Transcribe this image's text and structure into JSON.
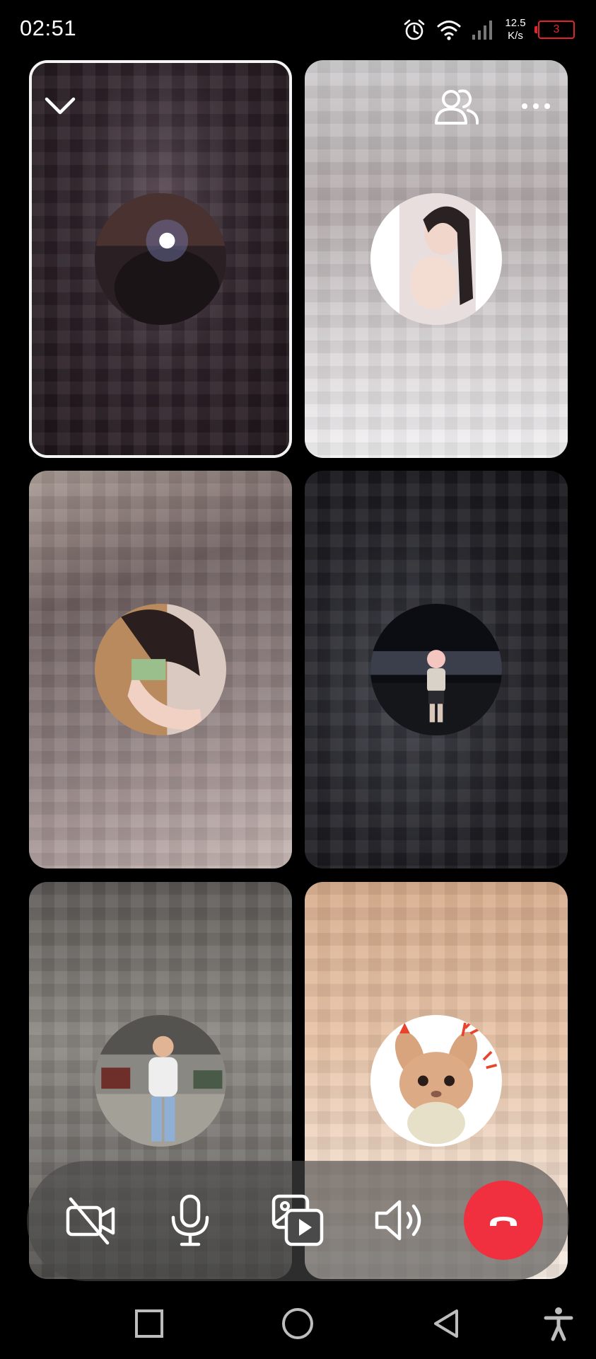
{
  "status_bar": {
    "time": "02:51",
    "net_speed_value": "12.5",
    "net_speed_unit": "K/s",
    "battery_level": "3",
    "icons": [
      "alarm-icon",
      "wifi-icon",
      "cell-signal-icon",
      "battery-icon"
    ]
  },
  "call": {
    "participant_count": 6,
    "participants": [
      {
        "id": 1,
        "role": "self-view",
        "avatar": "dark-room-selfie",
        "selected": true
      },
      {
        "id": 2,
        "avatar": "girl-portrait-photo"
      },
      {
        "id": 3,
        "avatar": "girl-lying-photo"
      },
      {
        "id": 4,
        "avatar": "man-night-street-photo"
      },
      {
        "id": 5,
        "avatar": "man-parking-lot-photo"
      },
      {
        "id": 6,
        "avatar": "plush-bunny-sticker"
      }
    ],
    "tile_icons": {
      "collapse": "chevron-down-icon",
      "participants": "people-icon",
      "more": "more-icon"
    }
  },
  "controls": {
    "buttons": [
      "camera-off-icon",
      "microphone-icon",
      "screen-share-icon",
      "speaker-icon",
      "end-call-icon"
    ],
    "end_call_color": "#f0303f",
    "bar_color": "#484848"
  },
  "nav_bar": {
    "buttons": [
      "recent-apps-icon",
      "home-icon",
      "back-icon",
      "accessibility-icon"
    ]
  }
}
